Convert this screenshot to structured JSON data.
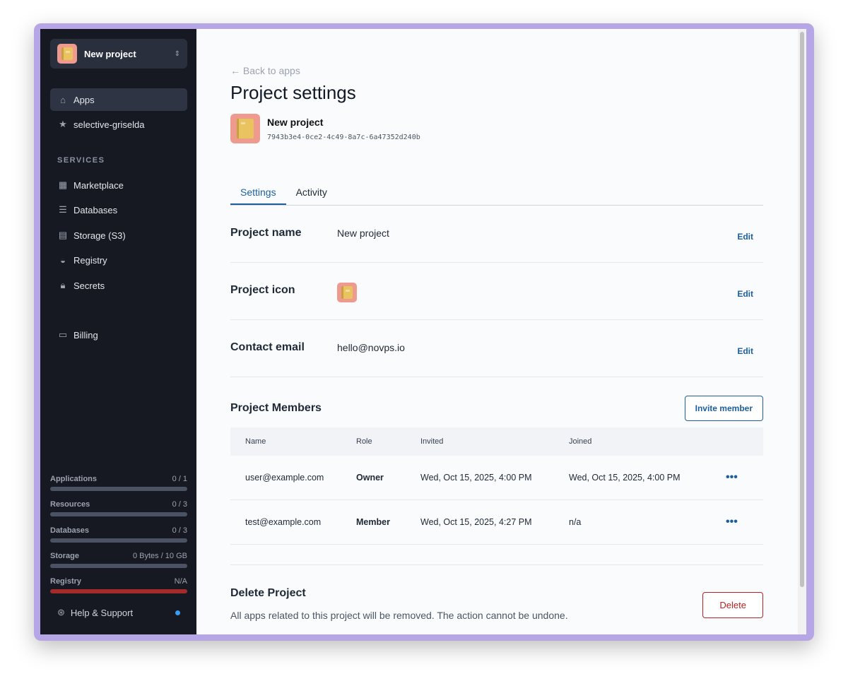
{
  "project": {
    "name": "New project",
    "id": "7943b3e4-0ce2-4c49-8a7c-6a47352d240b"
  },
  "sidebar": {
    "nav": [
      {
        "label": "Apps",
        "icon": "home-icon"
      },
      {
        "label": "selective-griselda",
        "icon": "star-icon"
      }
    ],
    "services_heading": "SERVICES",
    "services": [
      {
        "label": "Marketplace"
      },
      {
        "label": "Databases"
      },
      {
        "label": "Storage (S3)"
      },
      {
        "label": "Registry"
      },
      {
        "label": "Secrets"
      }
    ],
    "billing": "Billing",
    "usage": [
      {
        "label": "Applications",
        "value": "0 / 1",
        "fraction": 0
      },
      {
        "label": "Resources",
        "value": "0 / 3",
        "fraction": 0
      },
      {
        "label": "Databases",
        "value": "0 / 3",
        "fraction": 0
      },
      {
        "label": "Storage",
        "value": "0 Bytes / 10 GB",
        "fraction": 0
      },
      {
        "label": "Registry",
        "value": "N/A",
        "fraction": 1
      }
    ],
    "help": "Help & Support"
  },
  "main": {
    "back": "Back to apps",
    "title": "Project settings",
    "tabs": [
      "Settings",
      "Activity"
    ],
    "fields": [
      {
        "label": "Project name",
        "value": "New project",
        "edit": "Edit"
      },
      {
        "label": "Project icon",
        "value": "",
        "edit": "Edit"
      },
      {
        "label": "Contact email",
        "value": "hello@novps.io",
        "edit": "Edit"
      }
    ],
    "members": {
      "title": "Project Members",
      "invite": "Invite member",
      "columns": [
        "Name",
        "Role",
        "Invited",
        "Joined"
      ],
      "rows": [
        [
          "user@example.com",
          "Owner",
          "Wed, Oct 15, 2025, 4:00 PM",
          "Wed, Oct 15, 2025, 4:00 PM"
        ],
        [
          "test@example.com",
          "Member",
          "Wed, Oct 15, 2025, 4:27 PM",
          "n/a"
        ]
      ]
    },
    "delete": {
      "title": "Delete Project",
      "desc": "All apps related to this project will be removed. The action cannot be undone.",
      "button": "Delete"
    }
  }
}
